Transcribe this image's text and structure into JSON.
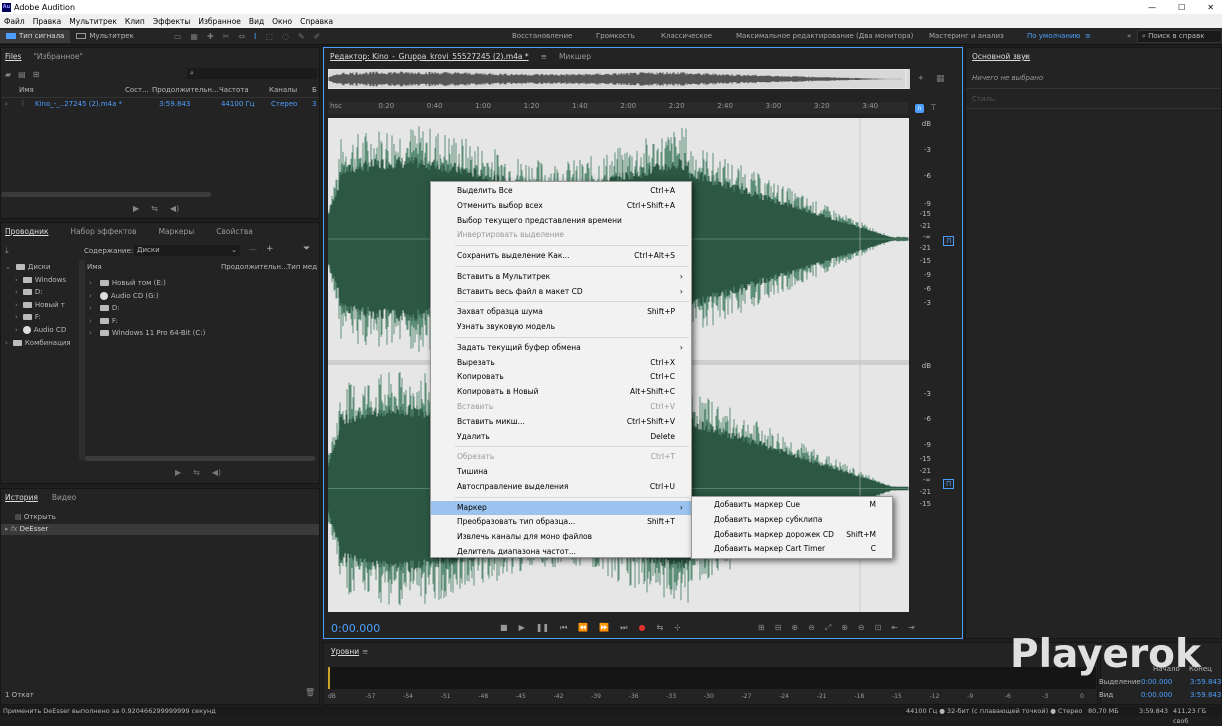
{
  "app": {
    "title": "Adobe Audition",
    "logo": "Au"
  },
  "menu": [
    "Файл",
    "Правка",
    "Мультитрек",
    "Клип",
    "Эффекты",
    "Избранное",
    "Вид",
    "Окно",
    "Справка"
  ],
  "toolbar": {
    "waveform": "Тип сигнала",
    "multitrack": "Мультитрек",
    "search": "Поиск в справк"
  },
  "workspaces": [
    "Восстановление",
    "Громкость",
    "Классическое",
    "Максимальное редактирование (Два монитора)",
    "Мастеринг и анализ",
    "По умолчанию"
  ],
  "files": {
    "tab": "Files",
    "fav": "\"Избранное\"",
    "headers": [
      "Имя",
      "Сост...",
      "Продолжительн...",
      "Частота",
      "Каналы",
      "Б"
    ],
    "row": {
      "name": "Kino_-_..27245 (2).m4a *",
      "duration": "3:59.843",
      "rate": "44100 Гц",
      "channels": "Стерео",
      "b": "3"
    }
  },
  "explorer": {
    "tabs": [
      "Проводник",
      "Набор эффектов",
      "Маркеры",
      "Свойства"
    ],
    "content_label": "Содержание:",
    "content_value": "Диски",
    "tree": [
      "Диски",
      "Windows",
      "D:",
      "Новый т",
      "F:",
      "Audio CD",
      "Комбинация"
    ],
    "list_headers": [
      "Имя",
      "Продолжительн...",
      "Тип мед"
    ],
    "list": [
      "Новый том (E:)",
      "Audio CD (G:)",
      "D:",
      "F:",
      "Windows 11 Pro 64-Bit (C:)"
    ]
  },
  "history": {
    "tabs": [
      "История",
      "Видео"
    ],
    "items": [
      "Открыть",
      "DeEsser"
    ],
    "count": "1 Откат"
  },
  "editor": {
    "tab": "Редактор: Kino_-_Gruppa_krovi_55527245 (2).m4a *",
    "mixer": "Микшер",
    "time": "0:00.000",
    "ruler": [
      "hsc",
      "0:20",
      "0:40",
      "1:00",
      "1:20",
      "1:40",
      "2:00",
      "2:20",
      "2:40",
      "3:00",
      "3:20",
      "3:40"
    ],
    "db_top": [
      "dB",
      "-3",
      "-6",
      "-9",
      "-15",
      "-21",
      "-∞",
      "-21",
      "-15",
      "-9",
      "-6",
      "-3"
    ],
    "db_bottom": [
      "dB",
      "-3",
      "-6",
      "-9",
      "-15",
      "-21",
      "-∞",
      "-21",
      "-15"
    ],
    "ch": [
      "Л",
      "П"
    ]
  },
  "context_menu": [
    {
      "label": "Выделить Все",
      "shortcut": "Ctrl+A"
    },
    {
      "label": "Отменить выбор всех",
      "shortcut": "Ctrl+Shift+A"
    },
    {
      "label": "Выбор текущего представления времени",
      "shortcut": ""
    },
    {
      "label": "Инвертировать выделение",
      "shortcut": "",
      "disabled": true
    },
    {
      "sep": true
    },
    {
      "label": "Сохранить выделение Как...",
      "shortcut": "Ctrl+Alt+S"
    },
    {
      "sep": true
    },
    {
      "label": "Вставить в Мультитрек",
      "submenu": true
    },
    {
      "label": "Вставить весь файл в макет CD",
      "submenu": true
    },
    {
      "sep": true
    },
    {
      "label": "Захват образца шума",
      "shortcut": "Shift+P"
    },
    {
      "label": "Узнать звуковую модель",
      "shortcut": ""
    },
    {
      "sep": true
    },
    {
      "label": "Задать текущий буфер обмена",
      "submenu": true
    },
    {
      "label": "Вырезать",
      "shortcut": "Ctrl+X"
    },
    {
      "label": "Копировать",
      "shortcut": "Ctrl+C"
    },
    {
      "label": "Копировать в Новый",
      "shortcut": "Alt+Shift+C"
    },
    {
      "label": "Вставить",
      "shortcut": "Ctrl+V",
      "disabled": true
    },
    {
      "label": "Вставить микш...",
      "shortcut": "Ctrl+Shift+V"
    },
    {
      "label": "Удалить",
      "shortcut": "Delete"
    },
    {
      "sep": true
    },
    {
      "label": "Обрезать",
      "shortcut": "Ctrl+T",
      "disabled": true
    },
    {
      "label": "Тишина",
      "shortcut": ""
    },
    {
      "label": "Автосправление выделения",
      "shortcut": "Ctrl+U"
    },
    {
      "sep": true
    },
    {
      "label": "Маркер",
      "submenu": true,
      "highlight": true
    },
    {
      "label": "Преобразовать тип образца...",
      "shortcut": "Shift+T"
    },
    {
      "label": "Извлечь каналы для моно файлов",
      "shortcut": ""
    },
    {
      "label": "Делитель диапазона частот...",
      "shortcut": ""
    }
  ],
  "submenu": [
    {
      "label": "Добавить маркер Cue",
      "shortcut": "M"
    },
    {
      "label": "Добавить маркер субклипа",
      "shortcut": ""
    },
    {
      "label": "Добавить маркер дорожек CD",
      "shortcut": "Shift+M"
    },
    {
      "label": "Добавить маркер Cart Timer",
      "shortcut": "C"
    }
  ],
  "essential": {
    "tab": "Основной звук",
    "empty": "Ничего не выбрано",
    "style": "Стиль:"
  },
  "levels": {
    "tab": "Уровни",
    "scale": [
      "dB",
      "-57",
      "-54",
      "-51",
      "-48",
      "-45",
      "-42",
      "-39",
      "-36",
      "-33",
      "-30",
      "-27",
      "-24",
      "-21",
      "-18",
      "-15",
      "-12",
      "-9",
      "-6",
      "-3",
      "0"
    ]
  },
  "selection": {
    "start_h": "Начало",
    "end_h": "Конец",
    "sel_label": "Выделение",
    "view_label": "Вид",
    "sel_start": "0:00.000",
    "sel_end": "3:59.843",
    "view_start": "0:00.000",
    "view_end": "3:59.843"
  },
  "status": {
    "left": "Применить DeEsser выполнено за 0.920466299999999 секунд",
    "right": "44100 Гц ● 32-бит (с плавающей точкой) ● Стерео",
    "mem": "80,70 МБ",
    "dur": "3:59.843",
    "free": "411,23 ГБ своб"
  },
  "watermark": "Playerok",
  "colors": {
    "wave": "#e8e8e8",
    "waveBg": "#2b5743",
    "accent": "#4c9ffe",
    "menuHl": "#9cc3ef"
  }
}
